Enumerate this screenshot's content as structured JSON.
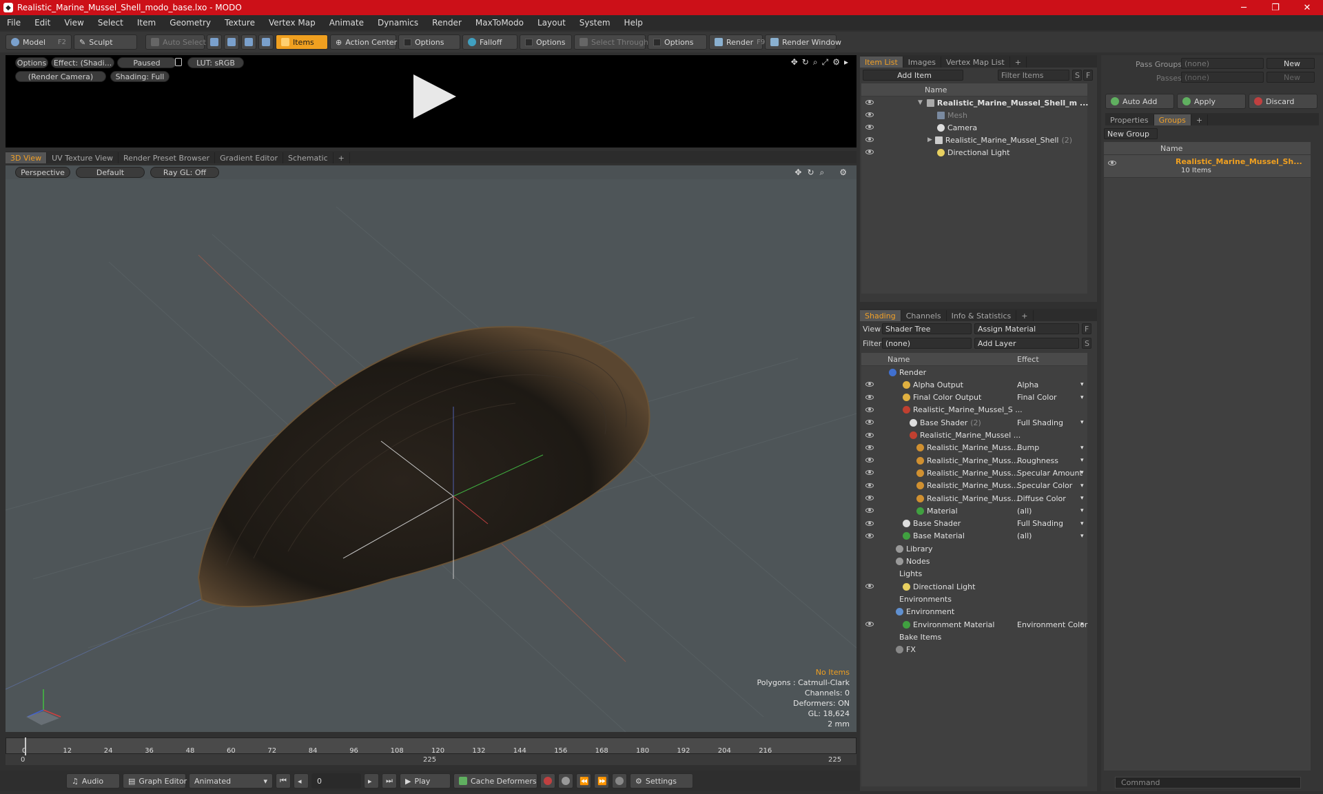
{
  "window": {
    "title": "Realistic_Marine_Mussel_Shell_modo_base.lxo - MODO",
    "app_icon": "modo-icon"
  },
  "menu": [
    "File",
    "Edit",
    "View",
    "Select",
    "Item",
    "Geometry",
    "Texture",
    "Vertex Map",
    "Animate",
    "Dynamics",
    "Render",
    "MaxToModo",
    "Layout",
    "System",
    "Help"
  ],
  "toolbar": {
    "model": "Model",
    "model_key": "F2",
    "sculpt": "Sculpt",
    "auto_select": "Auto Select",
    "items": "Items",
    "action_center": "Action Center",
    "options1": "Options",
    "falloff": "Falloff",
    "options2": "Options",
    "select_through": "Select Through",
    "options3": "Options",
    "render": "Render",
    "render_key": "F9",
    "render_window": "Render Window"
  },
  "preview": {
    "options": "Options",
    "effect": "Effect: (Shadi...",
    "paused": "Paused",
    "lut": "LUT: sRGB",
    "camera": "(Render Camera)",
    "shading": "Shading: Full"
  },
  "viewport_tabs": [
    "3D View",
    "UV Texture View",
    "Render Preset Browser",
    "Gradient Editor",
    "Schematic"
  ],
  "viewport": {
    "projection": "Perspective",
    "style": "Default",
    "raygl": "Ray GL: Off"
  },
  "stats": {
    "no_items": "No Items",
    "polygons": "Polygons : Catmull-Clark",
    "channels": "Channels: 0",
    "deformers": "Deformers: ON",
    "gl": "GL: 18,624",
    "scale": "2 mm"
  },
  "timeline": {
    "ticks": [
      "0",
      "12",
      "24",
      "36",
      "48",
      "60",
      "72",
      "84",
      "96",
      "108",
      "120",
      "132",
      "144",
      "156",
      "168",
      "180",
      "192",
      "204",
      "216"
    ],
    "start": "0",
    "mid": "225",
    "end": "225"
  },
  "bottom": {
    "audio": "Audio",
    "graph_editor": "Graph Editor",
    "animated": "Animated",
    "frame": "0",
    "play": "Play",
    "cache": "Cache Deformers",
    "settings": "Settings"
  },
  "item_list": {
    "tabs": [
      "Item List",
      "Images",
      "Vertex Map List"
    ],
    "add_item": "Add Item",
    "filter": "Filter Items",
    "s": "S",
    "f": "F",
    "col_name": "Name",
    "rows": [
      {
        "label": "Realistic_Marine_Mussel_Shell_m ..."
      },
      {
        "label": "Mesh"
      },
      {
        "label": "Camera"
      },
      {
        "label": "Realistic_Marine_Mussel_Shell",
        "count": "(2)"
      },
      {
        "label": "Directional Light"
      }
    ]
  },
  "shading": {
    "tabs": [
      "Shading",
      "Channels",
      "Info & Statistics"
    ],
    "view_label": "View",
    "view_value": "Shader Tree",
    "assign": "Assign Material",
    "f": "F",
    "filter_label": "Filter",
    "filter_value": "(none)",
    "add_layer": "Add Layer",
    "s": "S",
    "col_name": "Name",
    "col_effect": "Effect",
    "rows": [
      {
        "name": "Render",
        "effect": ""
      },
      {
        "name": "Alpha Output",
        "effect": "Alpha"
      },
      {
        "name": "Final Color Output",
        "effect": "Final Color"
      },
      {
        "name": "Realistic_Marine_Mussel_S ...",
        "effect": ""
      },
      {
        "name": "Base Shader",
        "count": "(2)",
        "effect": "Full Shading"
      },
      {
        "name": "Realistic_Marine_Mussel ...",
        "effect": ""
      },
      {
        "name": "Realistic_Marine_Muss...",
        "effect": "Bump"
      },
      {
        "name": "Realistic_Marine_Muss...",
        "effect": "Roughness"
      },
      {
        "name": "Realistic_Marine_Muss...",
        "effect": "Specular Amount"
      },
      {
        "name": "Realistic_Marine_Muss...",
        "effect": "Specular Color"
      },
      {
        "name": "Realistic_Marine_Muss...",
        "effect": "Diffuse Color"
      },
      {
        "name": "Material",
        "effect": "(all)"
      },
      {
        "name": "Base Shader",
        "effect": "Full Shading"
      },
      {
        "name": "Base Material",
        "effect": "(all)"
      },
      {
        "name": "Library",
        "effect": ""
      },
      {
        "name": "Nodes",
        "effect": ""
      },
      {
        "name": "Lights",
        "effect": ""
      },
      {
        "name": "Directional Light",
        "effect": ""
      },
      {
        "name": "Environments",
        "effect": ""
      },
      {
        "name": "Environment",
        "effect": ""
      },
      {
        "name": "Environment Material",
        "effect": "Environment Color"
      },
      {
        "name": "Bake Items",
        "effect": ""
      },
      {
        "name": "FX",
        "effect": ""
      }
    ]
  },
  "groups_panel": {
    "pass_groups": "Pass Groups",
    "pass_value": "(none)",
    "new": "New",
    "passes": "Passes",
    "passes_value": "(none)",
    "new2": "New",
    "auto_add": "Auto Add",
    "apply": "Apply",
    "discard": "Discard",
    "tabs": [
      "Properties",
      "Groups"
    ],
    "new_group": "New Group",
    "col_name": "Name",
    "group_name": "Realistic_Marine_Mussel_Sh...",
    "group_count": "10 Items"
  },
  "command": {
    "placeholder": "Command"
  },
  "colors": {
    "accent": "#f0a020",
    "title_bar": "#cc1018"
  }
}
